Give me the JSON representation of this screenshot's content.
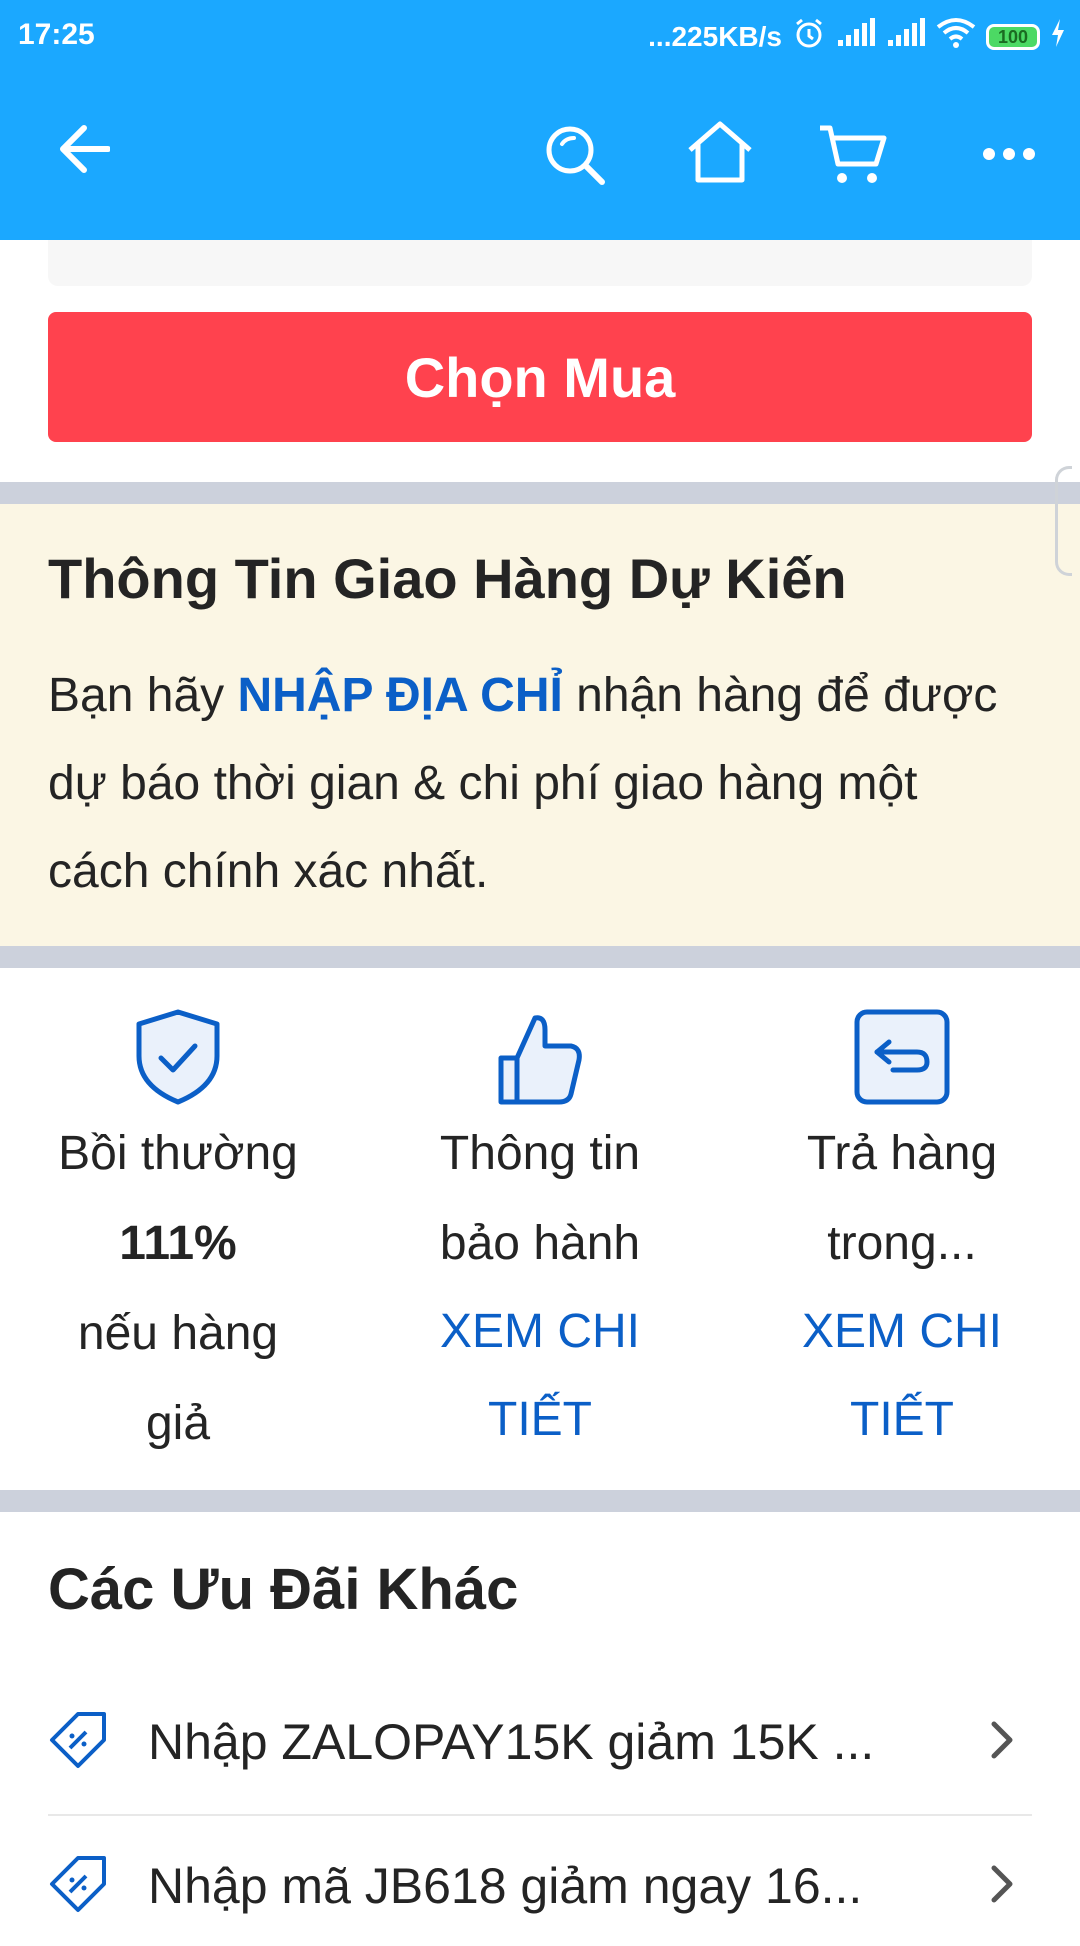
{
  "status_bar": {
    "time": "17:25",
    "network_speed": "...225KB/s",
    "battery": "100"
  },
  "app_bar": {
    "back_icon": "arrow-left-icon",
    "search_icon": "search-icon",
    "home_icon": "home-icon",
    "cart_icon": "cart-icon",
    "more_icon": "more-dots-icon"
  },
  "buy_button": {
    "label": "Chọn Mua"
  },
  "delivery": {
    "title": "Thông Tin Giao Hàng Dự Kiến",
    "text_before": "Bạn hãy ",
    "link": "NHẬP ĐỊA CHỈ",
    "text_after": " nhận hàng để được dự báo thời gian & chi phí giao hàng một cách chính xác nhất."
  },
  "features": [
    {
      "icon": "shield-check-icon",
      "line1": "Bồi thường",
      "line2": "111%",
      "line3": "nếu hàng",
      "line4": "giả"
    },
    {
      "icon": "thumbs-up-icon",
      "line1": "Thông tin",
      "line2": "bảo hành",
      "link": "XEM CHI TIẾT"
    },
    {
      "icon": "return-icon",
      "line1": "Trả hàng",
      "line2": "trong...",
      "link_line1": "XEM CHI",
      "link_line2": "TIẾT"
    }
  ],
  "offers": {
    "title": "Các Ưu Đãi Khác",
    "items": [
      {
        "icon": "coupon-icon",
        "text": "Nhập ZALOPAY15K giảm 15K ..."
      },
      {
        "icon": "coupon-icon",
        "text": "Nhập mã JB618 giảm ngay 16..."
      }
    ]
  },
  "colors": {
    "primary_blue": "#1ba8ff",
    "buy_red": "#ff424e",
    "link_blue": "#0b5fc7",
    "delivery_bg": "#fbf6e4"
  }
}
